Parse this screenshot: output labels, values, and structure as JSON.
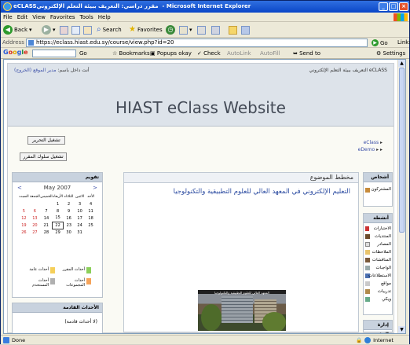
{
  "window": {
    "title": "‏eCLASS‏ مقرر دراسي: التعريف ببيئة التعلم الإلكتروني - Microsoft Internet Explorer",
    "minimize": "_",
    "maximize": "□",
    "close": "×"
  },
  "menu": [
    "File",
    "Edit",
    "View",
    "Favorites",
    "Tools",
    "Help"
  ],
  "toolbar": {
    "back": "Back",
    "search": "Search",
    "favorites": "Favorites"
  },
  "address": {
    "label": "Address",
    "url": "https://eclass.hiast.edu.sy/course/view.php?id=20",
    "go": "Go",
    "links": "Links"
  },
  "google": {
    "letters": [
      "G",
      "o",
      "o",
      "g",
      "l",
      "e"
    ],
    "go_label": "Go",
    "bookmarks": "Bookmarks",
    "popups": "Popups okay",
    "check": "Check",
    "autolink": "AutoLink",
    "autofill": "AutoFill",
    "sendto": "Send to",
    "settings": "Settings"
  },
  "page": {
    "login_info": "أنت داخل باسم: ",
    "login_user": "مدير الموقع",
    "logout": "(الخروج)",
    "top_crumb": "التعريف ببيئة التعلم الإلكتروني eCLASS",
    "site_title": "HIAST eClass Website",
    "btn_role": "تبديل الدور...",
    "btn_edit": "تشغيل التحرير",
    "btn_admin": "تشغيل سلوك المقرر",
    "crumbs": [
      "eClass",
      "eDemo"
    ]
  },
  "calendar": {
    "header": "تقويم",
    "prev": "<",
    "next": ">",
    "month": "May 2007",
    "days": [
      "السبت",
      "الجمعة",
      "الخميس",
      "الأربعاء",
      "الثلاثاء",
      "الاثنين",
      "الأحد"
    ],
    "weeks": [
      [
        "",
        "",
        "",
        "1",
        "2",
        "3",
        "4"
      ],
      [
        "5",
        "6",
        "7",
        "8",
        "9",
        "10",
        "11"
      ],
      [
        "12",
        "13",
        "14",
        "15",
        "16",
        "17",
        "18"
      ],
      [
        "19",
        "20",
        "21",
        "22",
        "23",
        "24",
        "25"
      ],
      [
        "26",
        "27",
        "28",
        "29",
        "30",
        "31",
        ""
      ]
    ],
    "today": "22",
    "legend": [
      "أحداث المقرر",
      "أحداث عامة",
      "أحداث المجموعات",
      "أحداث المستخدم"
    ]
  },
  "upcoming": {
    "header": "الأحداث القادمة",
    "content": "(لا أحداث قادمة)"
  },
  "center": {
    "header": "مخطط الموضوع",
    "title": "التعليم الإلكتروني في المعهد العالي للعلوم التطبيقية والتكنولوجيا",
    "photo_sign": "المعهد العالي للعلوم التطبيقية والتكنولوجيا"
  },
  "right": {
    "people_header": "أشخاص",
    "participants": "المشتركون",
    "activities_header": "أنشطة",
    "activities": [
      "الاختبارات",
      "المنتديات",
      "المصادر",
      "الملاحظات",
      "المناقشات",
      "الواجبات",
      "الاستطلاعات",
      "مواقع",
      "تدريبات",
      "ويكي"
    ],
    "admin_header": "إدارة المقرر"
  },
  "status": {
    "done": "Done",
    "zone": "Internet"
  }
}
